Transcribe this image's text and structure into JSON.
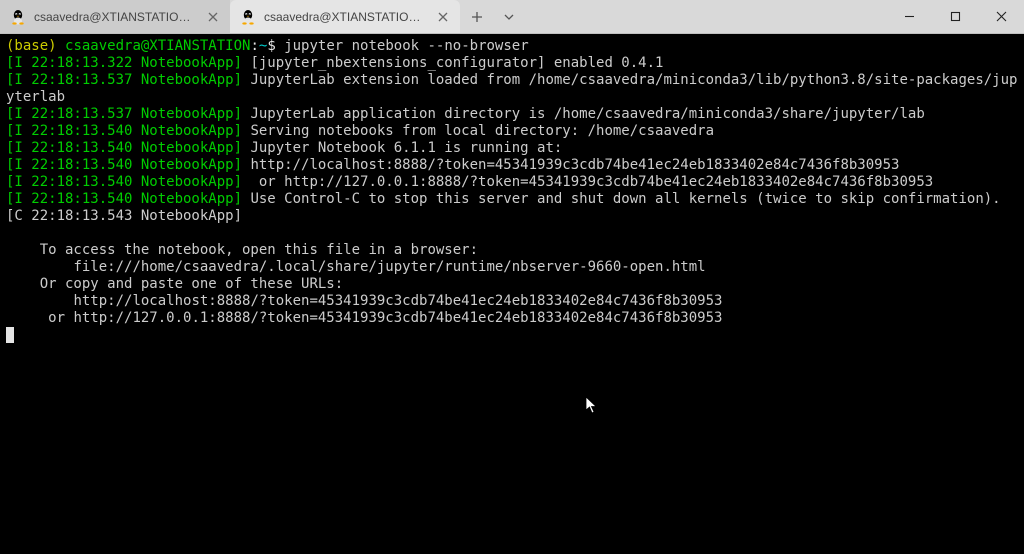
{
  "tabs": [
    {
      "title": "csaavedra@XTIANSTATION: /mn",
      "active": false
    },
    {
      "title": "csaavedra@XTIANSTATION: ~",
      "active": true
    }
  ],
  "prompt": {
    "env": "(base)",
    "userhost": "csaavedra@XTIANSTATION",
    "sep": ":",
    "cwd": "~",
    "dollar": "$",
    "command": "jupyter notebook --no-browser"
  },
  "lines": [
    {
      "tag": "[I 22:18:13.322 NotebookApp]",
      "body": " [jupyter_nbextensions_configurator] enabled 0.4.1"
    },
    {
      "tag": "[I 22:18:13.537 NotebookApp]",
      "body": " JupyterLab extension loaded from /home/csaavedra/miniconda3/lib/python3.8/site-packages/jupyterlab"
    },
    {
      "tag": "[I 22:18:13.537 NotebookApp]",
      "body": " JupyterLab application directory is /home/csaavedra/miniconda3/share/jupyter/lab"
    },
    {
      "tag": "[I 22:18:13.540 NotebookApp]",
      "body": " Serving notebooks from local directory: /home/csaavedra"
    },
    {
      "tag": "[I 22:18:13.540 NotebookApp]",
      "body": " Jupyter Notebook 6.1.1 is running at:"
    },
    {
      "tag": "[I 22:18:13.540 NotebookApp]",
      "body": " http://localhost:8888/?token=45341939c3cdb74be41ec24eb1833402e84c7436f8b30953"
    },
    {
      "tag": "[I 22:18:13.540 NotebookApp]",
      "body": "  or http://127.0.0.1:8888/?token=45341939c3cdb74be41ec24eb1833402e84c7436f8b30953"
    },
    {
      "tag": "[I 22:18:13.540 NotebookApp]",
      "body": " Use Control-C to stop this server and shut down all kernels (twice to skip confirmation)."
    }
  ],
  "cline": {
    "tag": "[C 22:18:13.543 NotebookApp]",
    "body": ""
  },
  "tail": [
    "",
    "    To access the notebook, open this file in a browser:",
    "        file:///home/csaavedra/.local/share/jupyter/runtime/nbserver-9660-open.html",
    "    Or copy and paste one of these URLs:",
    "        http://localhost:8888/?token=45341939c3cdb74be41ec24eb1833402e84c7436f8b30953",
    "     or http://127.0.0.1:8888/?token=45341939c3cdb74be41ec24eb1833402e84c7436f8b30953"
  ]
}
